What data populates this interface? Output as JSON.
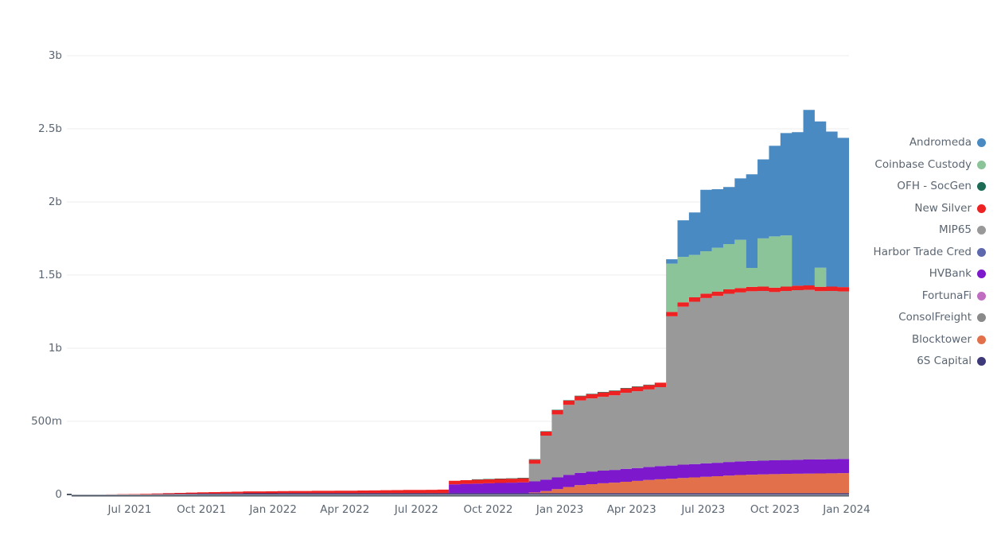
{
  "chart_data": {
    "type": "area",
    "stacked": true,
    "title": "",
    "subtitle": "",
    "xlabel": "",
    "ylabel": "",
    "grid": true,
    "legend_position": "right",
    "ylim": [
      0,
      3450000000
    ],
    "y_ticks": [
      0,
      500000000,
      1000000000,
      1500000000,
      2000000000,
      2500000000,
      3000000000
    ],
    "y_tick_labels": [
      "0",
      "500m",
      "1b",
      "1.5b",
      "2b",
      "2.5b",
      "3b"
    ],
    "x_tick_labels": [
      "Jul 2021",
      "Oct 2021",
      "Jan 2022",
      "Apr 2022",
      "Jul 2022",
      "Oct 2022",
      "Jan 2023",
      "Apr 2023",
      "Jul 2023",
      "Oct 2023",
      "Jan 2024"
    ],
    "x_start": "2021-05-01",
    "x_end": "2024-02-15",
    "x_count": 69,
    "colors": {
      "Andromeda": "#4a8ac2",
      "Coinbase Custody": "#8cc49a",
      "OFH - SocGen": "#1d6b55",
      "New Silver": "#ee2222",
      "MIP65": "#999999",
      "Harbor Trade Cred": "#5d68ad",
      "HVBank": "#7d18cc",
      "FortunaFi": "#c06cc0",
      "ConsolFreight": "#8a8a8a",
      "Blocktower": "#e2714b",
      "6S Capital": "#3e3a7a"
    },
    "stack_order_bottom_to_top": [
      "6S Capital",
      "ConsolFreight",
      "FortunaFi",
      "Harbor Trade Cred",
      "Blocktower",
      "HVBank",
      "MIP65",
      "New Silver",
      "OFH - SocGen",
      "Coinbase Custody",
      "Andromeda"
    ],
    "series": [
      {
        "name": "6S Capital",
        "color": "#3e3a7a",
        "values": [
          0,
          0,
          0,
          0,
          0,
          0,
          1000000,
          2000000,
          3000000,
          4000000,
          5000000,
          6000000,
          6000000,
          7000000,
          7000000,
          8000000,
          8000000,
          8000000,
          9000000,
          9000000,
          9000000,
          9000000,
          9000000,
          9000000,
          9000000,
          9000000,
          9000000,
          9000000,
          9000000,
          9000000,
          9000000,
          9000000,
          9000000,
          9000000,
          9000000,
          9000000,
          9000000,
          9000000,
          9000000,
          9000000,
          9000000,
          9000000,
          9000000,
          9000000,
          9000000,
          9000000,
          9000000,
          9000000,
          9000000,
          9000000,
          9000000,
          9000000,
          9000000,
          9000000,
          9000000,
          9000000,
          9000000,
          9000000,
          9000000,
          9000000,
          9000000,
          9000000,
          9000000,
          9000000,
          9000000,
          9000000,
          9000000,
          9000000,
          9000000
        ]
      },
      {
        "name": "ConsolFreight",
        "color": "#8a8a8a",
        "values": [
          0,
          0,
          0,
          0,
          0,
          0,
          0,
          0,
          0,
          0,
          0,
          0,
          0,
          0,
          0,
          0,
          0,
          0,
          0,
          0,
          0,
          0,
          0,
          0,
          0,
          0,
          0,
          0,
          0,
          0,
          0,
          0,
          0,
          0,
          0,
          0,
          0,
          0,
          0,
          0,
          0,
          0,
          0,
          0,
          0,
          0,
          0,
          0,
          0,
          0,
          0,
          0,
          0,
          0,
          0,
          0,
          0,
          0,
          0,
          0,
          0,
          0,
          0,
          0,
          0,
          0,
          0,
          0,
          0
        ]
      },
      {
        "name": "FortunaFi",
        "color": "#c06cc0",
        "values": [
          0,
          0,
          0,
          0,
          0,
          0,
          0,
          0,
          0,
          0,
          0,
          0,
          0,
          0,
          0,
          0,
          0,
          0,
          0,
          0,
          0,
          0,
          0,
          0,
          0,
          0,
          0,
          0,
          0,
          0,
          0,
          0,
          0,
          0,
          0,
          0,
          0,
          0,
          0,
          0,
          0,
          0,
          0,
          0,
          0,
          0,
          0,
          0,
          0,
          0,
          0,
          0,
          0,
          0,
          0,
          0,
          0,
          0,
          0,
          0,
          0,
          0,
          0,
          0,
          0,
          0,
          0,
          0,
          0
        ]
      },
      {
        "name": "Harbor Trade Cred",
        "color": "#5d68ad",
        "values": [
          0,
          0,
          0,
          0,
          0,
          0,
          0,
          0,
          0,
          0,
          0,
          0,
          0,
          0,
          0,
          0,
          0,
          0,
          0,
          0,
          0,
          0,
          0,
          0,
          0,
          0,
          0,
          0,
          0,
          0,
          0,
          0,
          0,
          0,
          0,
          0,
          0,
          0,
          0,
          0,
          0,
          0,
          0,
          0,
          0,
          0,
          0,
          0,
          0,
          0,
          0,
          0,
          0,
          0,
          0,
          0,
          0,
          0,
          0,
          0,
          0,
          0,
          0,
          0,
          0,
          0,
          0,
          0,
          0
        ]
      },
      {
        "name": "Blocktower",
        "color": "#e2714b",
        "values": [
          0,
          0,
          0,
          0,
          0,
          0,
          0,
          0,
          0,
          0,
          0,
          0,
          0,
          0,
          0,
          0,
          0,
          0,
          0,
          0,
          0,
          0,
          0,
          0,
          0,
          0,
          0,
          0,
          0,
          0,
          0,
          0,
          0,
          0,
          0,
          0,
          0,
          0,
          0,
          0,
          5000000,
          15000000,
          28000000,
          42000000,
          55000000,
          62000000,
          68000000,
          72000000,
          78000000,
          84000000,
          90000000,
          95000000,
          99000000,
          104000000,
          108000000,
          112000000,
          116000000,
          120000000,
          124000000,
          126000000,
          128000000,
          130000000,
          132000000,
          133000000,
          134000000,
          135000000,
          136000000,
          137000000,
          138000000
        ]
      },
      {
        "name": "HVBank",
        "color": "#7d18cc",
        "values": [
          0,
          0,
          0,
          0,
          0,
          0,
          0,
          0,
          0,
          0,
          0,
          0,
          0,
          0,
          0,
          0,
          0,
          0,
          0,
          0,
          0,
          0,
          0,
          0,
          0,
          0,
          0,
          0,
          0,
          0,
          0,
          0,
          0,
          60000000,
          64000000,
          66000000,
          68000000,
          70000000,
          72000000,
          74000000,
          76000000,
          78000000,
          80000000,
          82000000,
          84000000,
          86000000,
          86000000,
          87000000,
          88000000,
          88000000,
          89000000,
          90000000,
          90000000,
          91000000,
          91000000,
          92000000,
          92000000,
          93000000,
          93000000,
          94000000,
          94000000,
          95000000,
          95000000,
          95000000,
          96000000,
          96000000,
          96000000,
          97000000,
          97000000
        ]
      },
      {
        "name": "MIP65",
        "color": "#999999",
        "values": [
          0,
          0,
          0,
          0,
          0,
          0,
          0,
          0,
          0,
          0,
          0,
          0,
          0,
          0,
          0,
          0,
          0,
          0,
          0,
          0,
          0,
          0,
          0,
          0,
          0,
          0,
          0,
          0,
          0,
          0,
          0,
          0,
          0,
          0,
          0,
          0,
          0,
          0,
          0,
          0,
          120000000,
          300000000,
          430000000,
          480000000,
          495000000,
          500000000,
          505000000,
          510000000,
          520000000,
          525000000,
          530000000,
          540000000,
          1020000000,
          1080000000,
          1110000000,
          1130000000,
          1140000000,
          1150000000,
          1155000000,
          1160000000,
          1160000000,
          1150000000,
          1155000000,
          1160000000,
          1160000000,
          1150000000,
          1150000000,
          1145000000,
          1145000000
        ]
      },
      {
        "name": "New Silver",
        "color": "#ee2222",
        "values": [
          0,
          0,
          0,
          1000000,
          2000000,
          3000000,
          4000000,
          5000000,
          6000000,
          7000000,
          8000000,
          9000000,
          10000000,
          11000000,
          12000000,
          13000000,
          13000000,
          14000000,
          14000000,
          15000000,
          15000000,
          16000000,
          16000000,
          17000000,
          17000000,
          18000000,
          19000000,
          20000000,
          21000000,
          22000000,
          22000000,
          23000000,
          24000000,
          25000000,
          25000000,
          26000000,
          26000000,
          27000000,
          27000000,
          28000000,
          28000000,
          28000000,
          29000000,
          29000000,
          29000000,
          29000000,
          30000000,
          30000000,
          30000000,
          30000000,
          30000000,
          30000000,
          30000000,
          30000000,
          30000000,
          30000000,
          30000000,
          30000000,
          30000000,
          30000000,
          30000000,
          30000000,
          30000000,
          30000000,
          30000000,
          30000000,
          30000000,
          30000000,
          30000000
        ]
      },
      {
        "name": "OFH - SocGen",
        "color": "#1d6b55",
        "values": [
          0,
          0,
          0,
          0,
          0,
          0,
          0,
          0,
          0,
          0,
          0,
          0,
          0,
          0,
          0,
          0,
          0,
          0,
          0,
          0,
          0,
          0,
          0,
          0,
          0,
          0,
          0,
          0,
          0,
          0,
          0,
          0,
          0,
          0,
          0,
          3000000,
          3000000,
          3000000,
          3000000,
          3000000,
          3000000,
          3000000,
          3000000,
          3000000,
          3000000,
          3000000,
          3000000,
          3000000,
          3000000,
          3000000,
          3000000,
          0,
          0,
          0,
          0,
          0,
          0,
          0,
          0,
          0,
          0,
          0,
          0,
          0,
          0,
          0,
          0,
          0,
          0
        ]
      },
      {
        "name": "Coinbase Custody",
        "color": "#8cc49a",
        "values": [
          0,
          0,
          0,
          0,
          0,
          0,
          0,
          0,
          0,
          0,
          0,
          0,
          0,
          0,
          0,
          0,
          0,
          0,
          0,
          0,
          0,
          0,
          0,
          0,
          0,
          0,
          0,
          0,
          0,
          0,
          0,
          0,
          0,
          0,
          0,
          0,
          0,
          0,
          0,
          0,
          0,
          0,
          0,
          0,
          0,
          0,
          0,
          0,
          0,
          0,
          0,
          0,
          330000000,
          310000000,
          290000000,
          290000000,
          300000000,
          310000000,
          330000000,
          130000000,
          330000000,
          350000000,
          350000000,
          0,
          0,
          130000000,
          0,
          0,
          130000000
        ]
      },
      {
        "name": "Andromeda",
        "color": "#4a8ac2",
        "values": [
          0,
          0,
          0,
          0,
          0,
          0,
          0,
          0,
          0,
          0,
          0,
          0,
          0,
          0,
          0,
          0,
          0,
          0,
          0,
          0,
          0,
          0,
          0,
          0,
          0,
          0,
          0,
          0,
          0,
          0,
          0,
          0,
          0,
          0,
          0,
          0,
          0,
          0,
          0,
          0,
          0,
          0,
          0,
          0,
          0,
          0,
          0,
          0,
          0,
          0,
          0,
          0,
          30000000,
          250000000,
          290000000,
          420000000,
          400000000,
          390000000,
          420000000,
          640000000,
          540000000,
          620000000,
          700000000,
          1050000000,
          1200000000,
          1000000000,
          1060000000,
          1020000000,
          900000000
        ]
      }
    ]
  },
  "legend": {
    "items": [
      {
        "label": "Andromeda",
        "color": "#4a8ac2"
      },
      {
        "label": "Coinbase Custody",
        "color": "#8cc49a"
      },
      {
        "label": "OFH - SocGen",
        "color": "#1d6b55"
      },
      {
        "label": "New Silver",
        "color": "#ee2222"
      },
      {
        "label": "MIP65",
        "color": "#999999"
      },
      {
        "label": "Harbor Trade Cred",
        "color": "#5d68ad"
      },
      {
        "label": "HVBank",
        "color": "#7d18cc"
      },
      {
        "label": "FortunaFi",
        "color": "#c06cc0"
      },
      {
        "label": "ConsolFreight",
        "color": "#8a8a8a"
      },
      {
        "label": "Blocktower",
        "color": "#e2714b"
      },
      {
        "label": "6S Capital",
        "color": "#3e3a7a"
      }
    ]
  },
  "axis": {
    "grid_color": "#eeeeee",
    "baseline_color": "#4b5563",
    "tick_text_color": "#5b6672"
  }
}
